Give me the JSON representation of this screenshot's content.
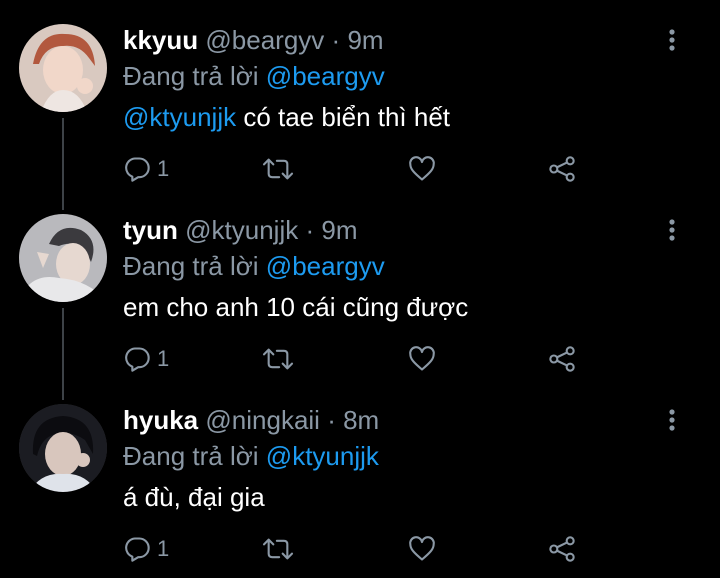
{
  "tweets": [
    {
      "name": "kkyuu",
      "handle": "@beargyv",
      "dot": "·",
      "time": "9m",
      "replying_prefix": "Đang trả lời",
      "replying_to": "@beargyv",
      "mention": "@ktyunjjk",
      "text": " có tae biển thì hết",
      "reply_count": "1",
      "avatar_color": "#b07a6a"
    },
    {
      "name": "tyun",
      "handle": "@ktyunjjk",
      "dot": "·",
      "time": "9m",
      "replying_prefix": "Đang trả lời",
      "replying_to": "@beargyv",
      "mention": "",
      "text": "em cho anh 10 cái cũng được",
      "reply_count": "1",
      "avatar_color": "#9a9aa0"
    },
    {
      "name": "hyuka",
      "handle": "@ningkaii",
      "dot": "·",
      "time": "8m",
      "replying_prefix": "Đang trả lời",
      "replying_to": "@ktyunjjk",
      "mention": "",
      "text": "á đù, đại gia",
      "reply_count": "1",
      "avatar_color": "#2a2c33"
    }
  ],
  "colors": {
    "background": "#000000",
    "secondary_text": "#8b98a5",
    "link": "#1d9bf0",
    "thread_line": "#3d4247"
  },
  "icons": [
    "more-vertical-icon",
    "reply-icon",
    "retweet-icon",
    "like-icon",
    "share-icon"
  ]
}
